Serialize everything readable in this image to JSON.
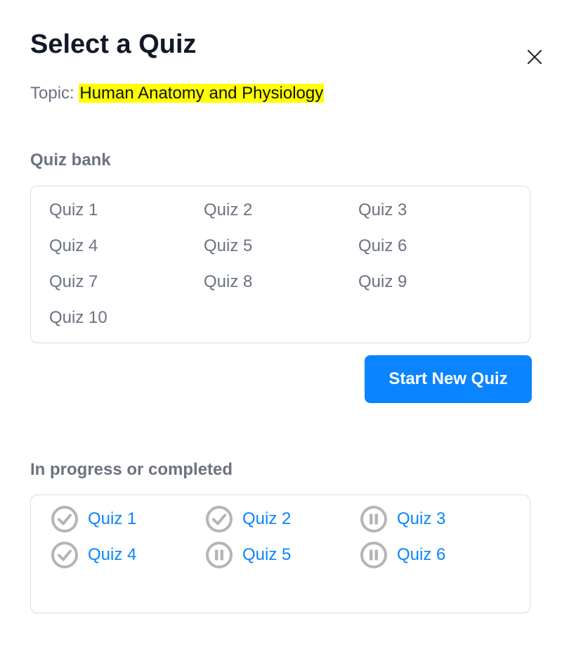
{
  "header": {
    "title": "Select a Quiz",
    "topic_label": "Topic:",
    "topic_value": "Human Anatomy and Physiology",
    "topic_highlight_color": "#ffff00"
  },
  "close_icon": "close-icon",
  "quiz_bank": {
    "label": "Quiz bank",
    "items": [
      "Quiz 1",
      "Quiz 2",
      "Quiz 3",
      "Quiz 4",
      "Quiz 5",
      "Quiz 6",
      "Quiz 7",
      "Quiz 8",
      "Quiz 9",
      "Quiz 10"
    ]
  },
  "start_button": {
    "label": "Start New Quiz",
    "color": "#0a84ff"
  },
  "in_progress": {
    "label": "In progress or completed",
    "items": [
      {
        "label": "Quiz 1",
        "status": "completed",
        "icon": "check-circle-icon"
      },
      {
        "label": "Quiz 2",
        "status": "completed",
        "icon": "check-circle-icon"
      },
      {
        "label": "Quiz 3",
        "status": "paused",
        "icon": "pause-circle-icon"
      },
      {
        "label": "Quiz 4",
        "status": "completed",
        "icon": "check-circle-icon"
      },
      {
        "label": "Quiz 5",
        "status": "paused",
        "icon": "pause-circle-icon"
      },
      {
        "label": "Quiz 6",
        "status": "paused",
        "icon": "pause-circle-icon"
      }
    ]
  },
  "colors": {
    "title": "#111827",
    "muted_text": "#6b7280",
    "link": "#0a84ff",
    "icon_gray": "#b5b5b5",
    "border": "#d9dbe0"
  }
}
